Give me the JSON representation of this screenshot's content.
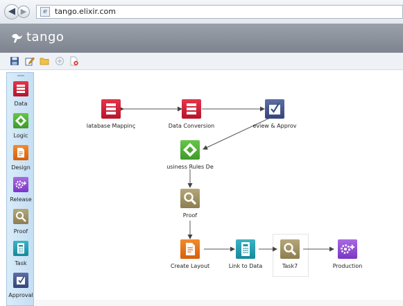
{
  "browser": {
    "url": "tango.elixir.com"
  },
  "app": {
    "brand": "tango"
  },
  "toolbar": {
    "buttons": [
      "save-icon",
      "edit-icon",
      "folder-icon",
      "add-icon",
      "delete-icon"
    ]
  },
  "palette": {
    "items": [
      {
        "label": "Data",
        "icon": "data-icon",
        "color": "#d0213a"
      },
      {
        "label": "Logic",
        "icon": "logic-icon",
        "color": "#52b03a"
      },
      {
        "label": "Design",
        "icon": "design-icon",
        "color": "#e8731b"
      },
      {
        "label": "Release",
        "icon": "release-icon",
        "color": "#9251d6"
      },
      {
        "label": "Proof",
        "icon": "proof-icon",
        "color": "#a39462"
      },
      {
        "label": "Task",
        "icon": "task-icon",
        "color": "#259fb0"
      },
      {
        "label": "Approval",
        "icon": "approval-icon",
        "color": "#46578f"
      }
    ]
  },
  "workflow": {
    "nodes": [
      {
        "label": "latabase Mappinç",
        "type": "data"
      },
      {
        "label": "Data Conversion",
        "type": "data"
      },
      {
        "label": "eview & Approv",
        "type": "approval"
      },
      {
        "label": "usiness Rules De",
        "type": "logic"
      },
      {
        "label": "Proof",
        "type": "proof"
      },
      {
        "label": "Create Layout",
        "type": "design"
      },
      {
        "label": "Link to Data",
        "type": "task"
      },
      {
        "label": "Task7",
        "type": "proof"
      },
      {
        "label": "Production",
        "type": "release"
      }
    ]
  }
}
